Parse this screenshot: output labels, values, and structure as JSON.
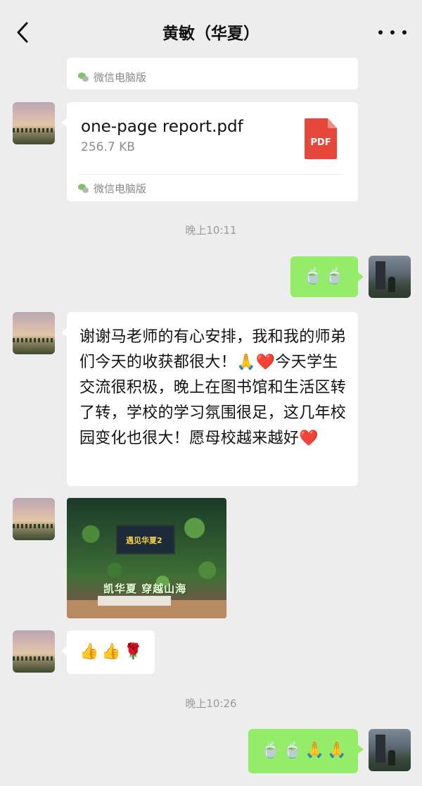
{
  "header": {
    "title": "黄敏（华夏）"
  },
  "messages": {
    "top_source": "微信电脑版",
    "file": {
      "name": "one-page report.pdf",
      "size": "256.7 KB",
      "icon_label": "PDF",
      "source": "微信电脑版"
    },
    "time1": "晚上10:11",
    "sent1_emojis": [
      "🍵",
      "🍵"
    ],
    "text_message": "谢谢马老师的有心安排，我和我的师弟们今天的收获都很大！🙏❤️今天学生交流很积极，晚上在图书馆和生活区转了转，学校的学习氛围很足，这几年校园变化也很大！愿母校越来越好❤️",
    "photo": {
      "screen_text": "遇见华夏2",
      "banner": "凯华夏 穿越山海"
    },
    "reaction_emojis": [
      "👍",
      "👍",
      "🌹"
    ],
    "time2": "晚上10:26",
    "sent2_emojis": [
      "🍵",
      "🍵",
      "🙏",
      "🙏"
    ]
  },
  "colors": {
    "background": "#ededed",
    "sent_bubble": "#95ec69",
    "received_bubble": "#ffffff",
    "pdf_red": "#e5483a",
    "muted_text": "#9a9a9a"
  },
  "icons": [
    "back-arrow-icon",
    "more-dots-icon",
    "wechat-pc-icon",
    "pdf-file-icon"
  ]
}
